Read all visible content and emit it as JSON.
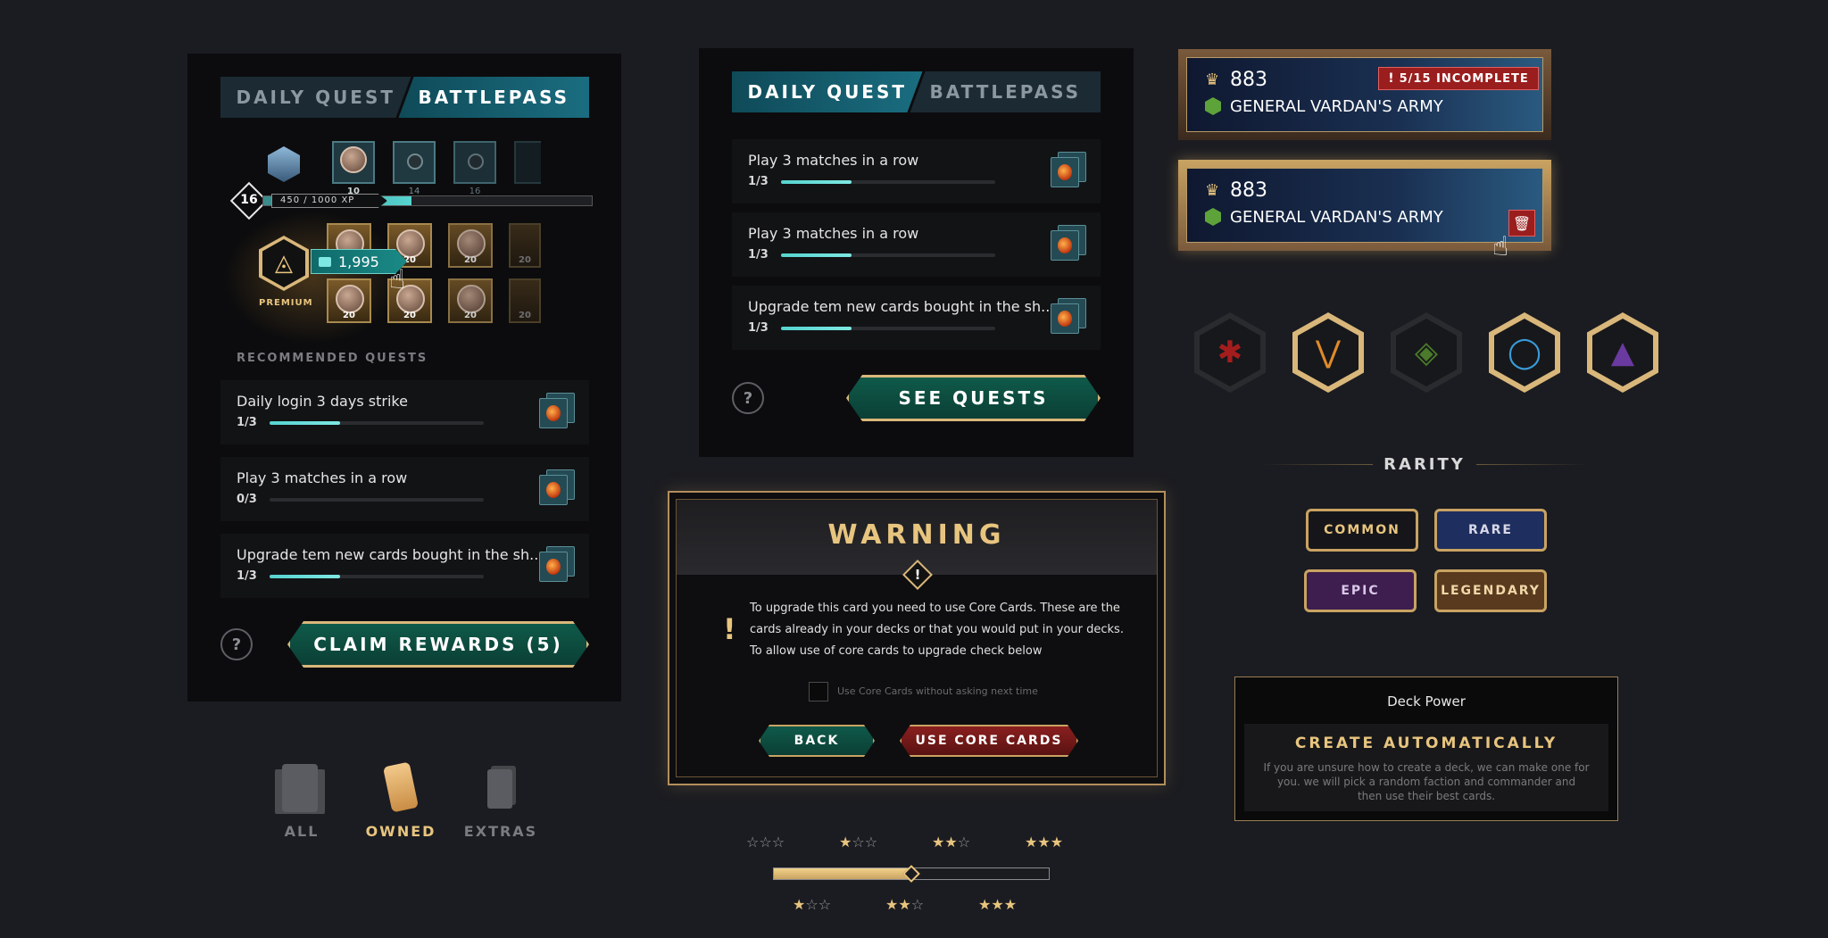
{
  "left_panel": {
    "tab_daily": "DAILY QUEST",
    "tab_battlepass": "BATTLEPASS",
    "level": "16",
    "xp_text": "450 / 1000 XP",
    "xp_fraction": 0.45,
    "top_rewards": [
      "10",
      "14",
      "16"
    ],
    "grid_rewards": [
      "20",
      "20",
      "20",
      "20",
      "20",
      "20",
      "20",
      "20"
    ],
    "premium_label": "PREMIUM",
    "price": "1,995",
    "recommended_label": "RECOMMENDED QUESTS",
    "quests": [
      {
        "title": "Daily login 3 days strike",
        "count": "1/3",
        "progress": 0.33
      },
      {
        "title": "Play 3 matches in a row",
        "count": "0/3",
        "progress": 0
      },
      {
        "title": "Upgrade tem new cards bought in the sh...",
        "count": "1/3",
        "progress": 0.33
      }
    ],
    "help": "?",
    "claim_button": "CLAIM REWARDS (5)"
  },
  "middle_panel": {
    "tab_daily": "DAILY QUEST",
    "tab_battlepass": "BATTLEPASS",
    "quests": [
      {
        "title": "Play 3 matches in a row",
        "count": "1/3",
        "progress": 0.33
      },
      {
        "title": "Play 3 matches in a row",
        "count": "1/3",
        "progress": 0.33
      },
      {
        "title": "Upgrade tem new cards bought in the sh...",
        "count": "1/3",
        "progress": 0.33
      }
    ],
    "help": "?",
    "see_button": "SEE QUESTS"
  },
  "filters": {
    "items": [
      "ALL",
      "OWNED",
      "EXTRAS"
    ],
    "selected": "OWNED"
  },
  "warning": {
    "title": "WARNING",
    "body_lines": [
      "To upgrade this card you need to use Core Cards. These are the",
      "cards already in your decks or that you would put in your decks.",
      "To allow use of core cards to upgrade check below"
    ],
    "checkbox_label": "Use Core Cards without asking next time",
    "back_button": "BACK",
    "use_button": "USE CORE CARDS"
  },
  "stars": {
    "progress": 0.5
  },
  "banners": [
    {
      "score": "883",
      "name": "GENERAL VARDAN'S ARMY",
      "badge": "5/15 INCOMPLETE"
    },
    {
      "score": "883",
      "name": "GENERAL VARDAN'S ARMY"
    }
  ],
  "rarity": {
    "title": "RARITY",
    "items": [
      "COMMON",
      "RARE",
      "EPIC",
      "LEGENDARY"
    ]
  },
  "deck_power": {
    "title": "Deck Power",
    "heading": "CREATE AUTOMATICALLY",
    "text_lines": [
      "If you are unsure how to create a deck, we can make one for",
      "you. we will pick a random faction and commander and",
      "then use their best cards."
    ]
  },
  "colors": {
    "accent_teal": "#56d4d0",
    "gold": "#e8c57f",
    "warning_red": "#8a1f1f"
  }
}
